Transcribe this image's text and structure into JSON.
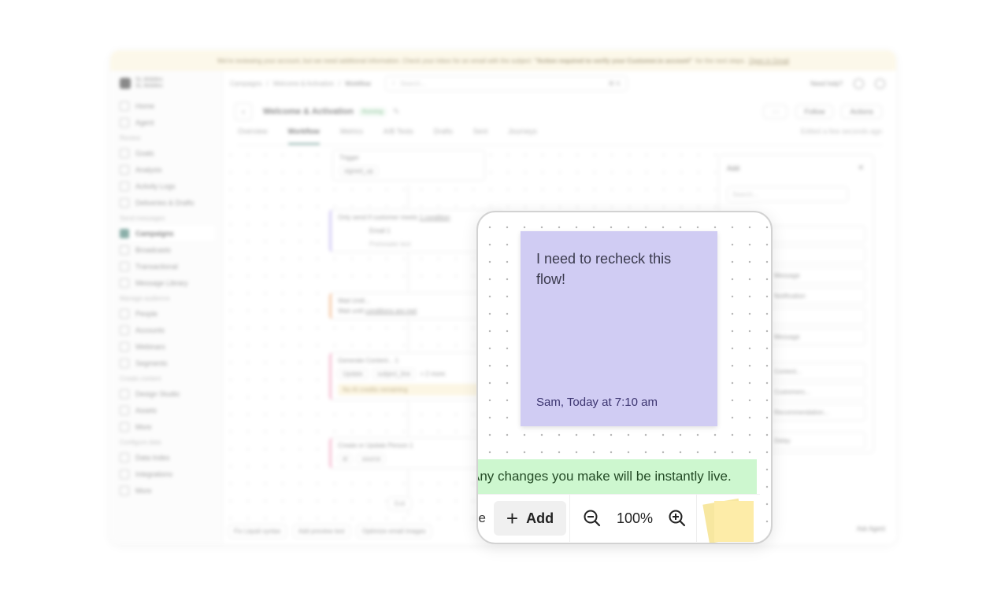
{
  "banner": {
    "text": "We're reviewing your account, but we need additional information. Check your inbox for an email with the subject",
    "subject": "\"Action required to verify your Customer.io account\"",
    "suffix": "for the next steps.",
    "link": "Open in Gmail"
  },
  "brand": {
    "workspace": "SL.Mobiles",
    "account": "SL.Mobiles"
  },
  "sidebar": {
    "top": [
      "Home",
      "Agent"
    ],
    "sections": [
      {
        "title": "Review",
        "items": [
          "Goals",
          "Analysis",
          "Activity Logs",
          "Deliveries & Drafts"
        ]
      },
      {
        "title": "Send messages",
        "items": [
          "Campaigns",
          "Broadcasts",
          "Transactional",
          "Message Library"
        ]
      },
      {
        "title": "Manage audience",
        "items": [
          "People",
          "Accounts",
          "Webinars",
          "Segments"
        ]
      },
      {
        "title": "Create content",
        "items": [
          "Design Studio",
          "Assets",
          "More"
        ]
      },
      {
        "title": "Configure data",
        "items": [
          "Data Index",
          "Integrations",
          "More"
        ]
      }
    ],
    "active": "Campaigns"
  },
  "topbar": {
    "breadcrumbs": [
      "Campaigns",
      "Welcome & Activation",
      "Workflow"
    ],
    "search_placeholder": "Search...",
    "search_shortcut": "⌘ K",
    "help": "Need help?"
  },
  "campaign": {
    "title": "Welcome & Activation",
    "status": "Running",
    "more": "···",
    "follow": "Follow",
    "actions": "Actions"
  },
  "tabs": [
    "Overview",
    "Workflow",
    "Metrics",
    "A/B Tests",
    "Drafts",
    "Sent",
    "Journeys"
  ],
  "active_tab": "Workflow",
  "edited": "Edited a few seconds ago",
  "workflow": {
    "trigger": {
      "label": "Trigger",
      "event": "signed_up"
    },
    "condition": {
      "text": "Only send if customer meets",
      "link": "1 condition"
    },
    "email": {
      "title": "Email 1",
      "subtitle": "Preheader text"
    },
    "wait": {
      "title": "Wait Until...",
      "text": "Wait until",
      "link": "conditions are met"
    },
    "generate": {
      "title": "Generate Content... 1",
      "label": "Update",
      "field": "subject_line",
      "more": "+ 2 more",
      "warning": "No AI credits remaining"
    },
    "create": {
      "title": "Create or Update Person 1",
      "chip1": "id",
      "chip2": "source"
    },
    "exit": "Exit"
  },
  "bottom_chips": [
    "Fix Liquid syntax",
    "Add preview text",
    "Optimize email images"
  ],
  "ask_agent": "Ask Agent",
  "add_panel": {
    "title": "Add",
    "search_placeholder": "Search...",
    "options": [
      "",
      "",
      "Message",
      "Notification",
      "",
      "Message",
      "Content...",
      "Customers...",
      "Recommendation...",
      "Delay"
    ]
  },
  "focus": {
    "note_text": "I need to recheck this flow!",
    "note_author": "Sam, Today at 7:10 am",
    "note_color": "#d0ccf3",
    "live_text": "Any changes you make will be instantly live.",
    "live_color": "#cdf7cf",
    "toolbar_cut_label": "e",
    "add_label": "Add",
    "zoom_level": "100%"
  }
}
